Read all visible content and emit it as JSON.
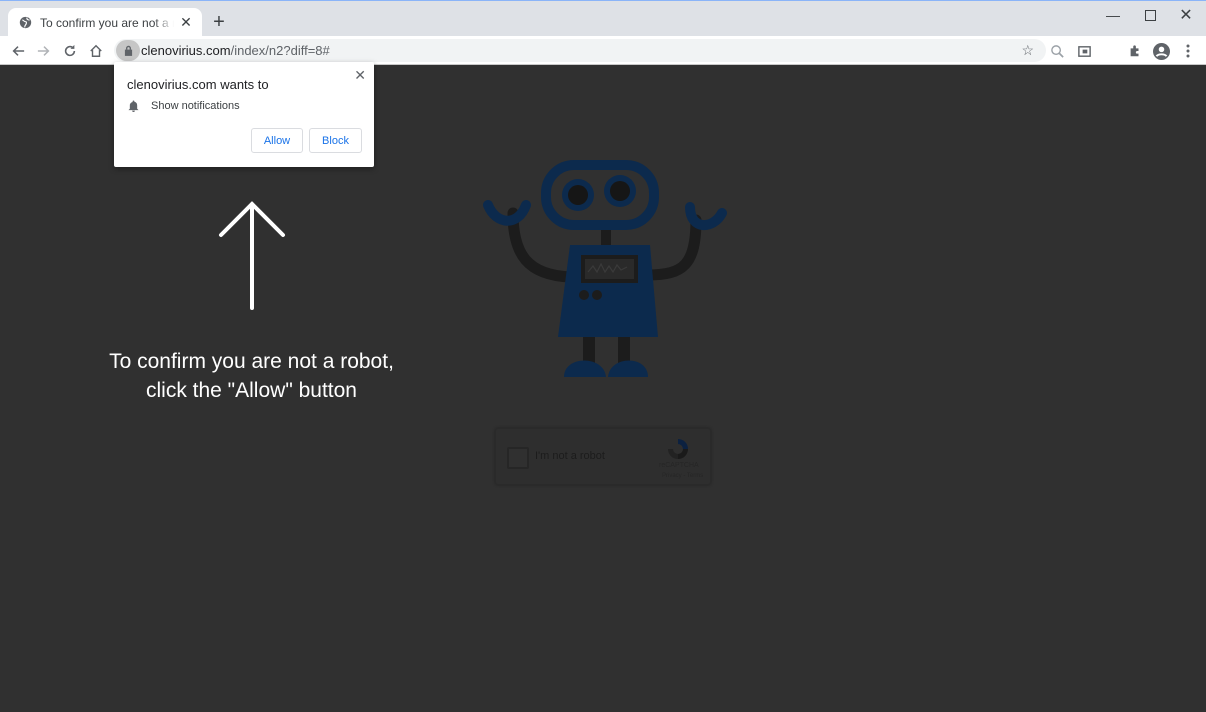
{
  "browser": {
    "tab": {
      "title": "To confirm you are not a robot, click the \"Allow\" button",
      "favicon": "globe-icon",
      "close_icon": "close-icon"
    },
    "new_tab_icon": "plus-icon",
    "window_controls": [
      "minimize-icon",
      "maximize-icon",
      "close-icon"
    ],
    "nav": [
      "back-icon",
      "forward-icon",
      "reload-icon",
      "home-icon"
    ],
    "address": {
      "host": "clenovirius.com",
      "path": "/index/n2?diff=8#",
      "secure_icon": "lock-icon"
    },
    "toolbar_icons": [
      "bookmark-star-icon",
      "zoom-icon",
      "reading-mode-icon",
      "extensions-icon",
      "profile-icon",
      "menu-icon"
    ]
  },
  "permission_prompt": {
    "title": "clenovirius.com wants to",
    "permission": "Show notifications",
    "permission_icon": "bell-icon",
    "allow_label": "Allow",
    "block_label": "Block"
  },
  "page": {
    "instruction_line1": "To confirm you are not a robot,",
    "instruction_line2": "click the \"Allow\" button",
    "captcha": {
      "label": "I'm not a robot",
      "brand": "reCAPTCHA",
      "links": "Privacy - Terms"
    },
    "colors": {
      "background": "#303030",
      "robot_blue": "#0c2a4d",
      "robot_dark": "#1c1c1c",
      "accent": "#1a73e8"
    }
  }
}
